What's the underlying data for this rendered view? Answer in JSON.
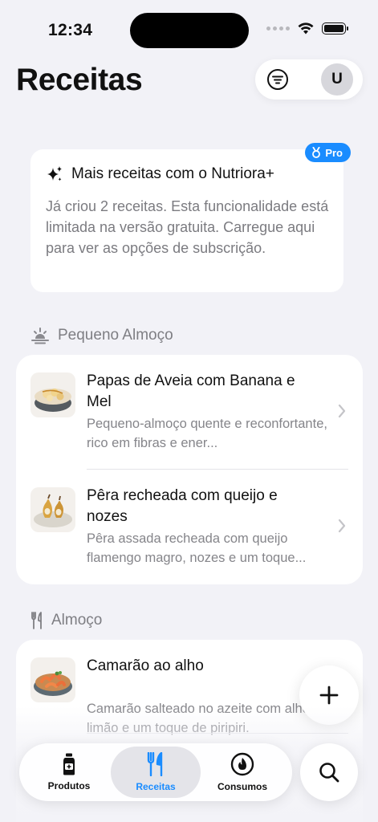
{
  "status_bar": {
    "time": "12:34"
  },
  "header": {
    "title": "Receitas",
    "avatar_initial": "U"
  },
  "promo": {
    "badge": "Pro",
    "title": "Mais receitas com o Nutriora+",
    "text": "Já criou 2 receitas. Esta funcionalidade está limitada na versão gratuita. Carregue aqui para ver as opções de subscrição."
  },
  "sections": [
    {
      "title": "Pequeno Almoço",
      "icon": "sunrise-icon",
      "recipes": [
        {
          "title": "Papas de Aveia com Banana e Mel",
          "description": "Pequeno-almoço quente e reconfortante, rico em fibras e ener..."
        },
        {
          "title": "Pêra recheada com queijo e nozes",
          "description": "Pêra assada recheada com queijo flamengo magro, nozes e um toque..."
        }
      ]
    },
    {
      "title": "Almoço",
      "icon": "fork-knife-icon",
      "recipes": [
        {
          "title": "Camarão ao alho",
          "description": "Camarão salteado no azeite com alho, limão e um toque de piripiri."
        }
      ]
    }
  ],
  "tab_bar": {
    "tabs": [
      {
        "label": "Produtos",
        "icon": "bottle-icon",
        "active": false
      },
      {
        "label": "Receitas",
        "icon": "fork-knife-icon",
        "active": true
      },
      {
        "label": "Consumos",
        "icon": "flame-icon",
        "active": false
      }
    ]
  },
  "colors": {
    "accent": "#1a8cff",
    "background": "#f2f2f7",
    "card": "#ffffff",
    "secondary_text": "#85858a"
  }
}
